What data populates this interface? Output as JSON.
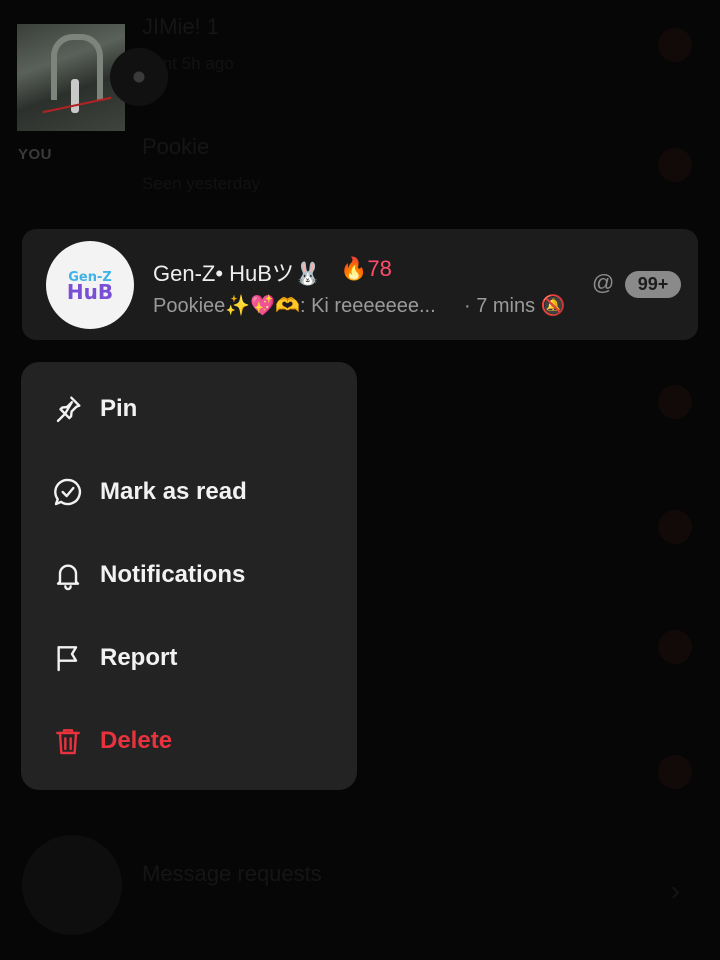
{
  "background": {
    "story": {
      "you_label": "YOU"
    },
    "rows": [
      {
        "title": "JIMie! 1",
        "subtitle": "Sent 5h ago"
      },
      {
        "title": "Pookie",
        "subtitle": "Seen yesterday"
      },
      {
        "title": "Message requests",
        "subtitle": ""
      }
    ]
  },
  "chat": {
    "title": "Gen-Z• HuBツ🐰",
    "streak": "🔥78",
    "preview": "Pookiee✨💖🫶: Ki reeeeeee...",
    "time": "· 7 mins 🔕",
    "mention": "@",
    "unread_count": "99+",
    "avatar_text_top": "Gen-Z",
    "avatar_text_bottom": "HuB"
  },
  "menu": {
    "items": [
      {
        "label": "Pin",
        "icon": "pin-icon"
      },
      {
        "label": "Mark as read",
        "icon": "mark-read-icon"
      },
      {
        "label": "Notifications",
        "icon": "bell-icon"
      },
      {
        "label": "Report",
        "icon": "flag-icon"
      },
      {
        "label": "Delete",
        "icon": "trash-icon"
      }
    ]
  },
  "colors": {
    "danger": "#e8323d",
    "streak": "#ff4d6a",
    "menu_bg": "#232324",
    "card_bg": "#1c1c1d"
  }
}
